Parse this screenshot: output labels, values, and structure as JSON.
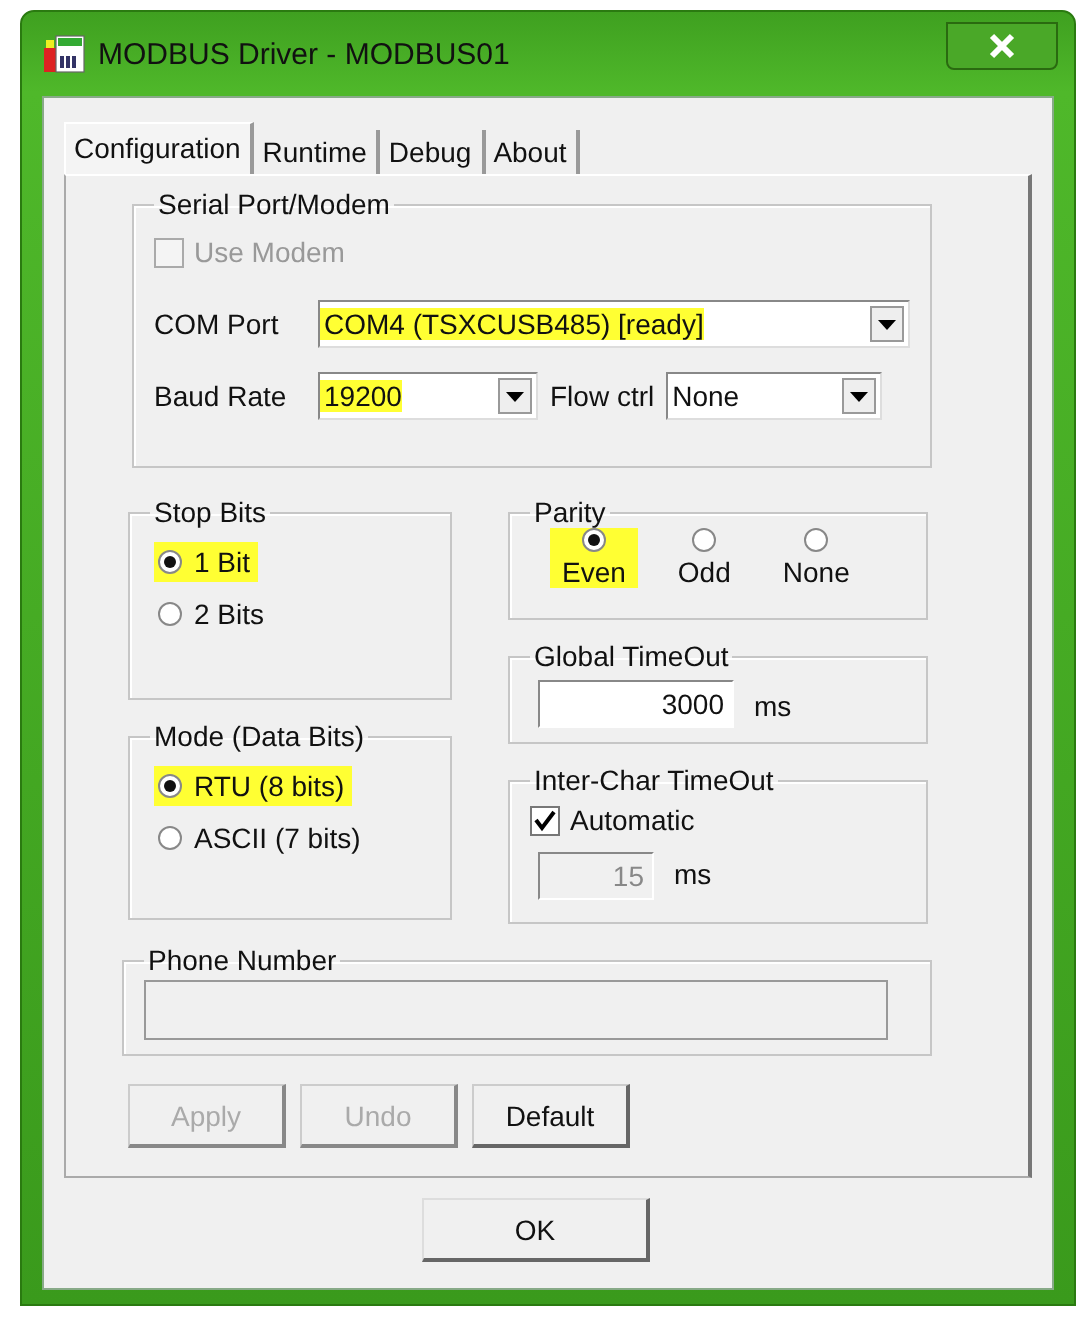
{
  "window": {
    "title": "MODBUS Driver - MODBUS01"
  },
  "tabs": [
    {
      "label": "Configuration",
      "selected": true
    },
    {
      "label": "Runtime",
      "selected": false
    },
    {
      "label": "Debug",
      "selected": false
    },
    {
      "label": "About",
      "selected": false
    }
  ],
  "serial_port": {
    "title": "Serial Port/Modem",
    "use_modem": {
      "label": "Use Modem",
      "checked": false,
      "disabled": true
    },
    "com_port": {
      "label": "COM Port",
      "value": "COM4 (TSXCUSB485) [ready]",
      "highlighted": true
    },
    "baud_rate": {
      "label": "Baud Rate",
      "value": "19200",
      "highlighted": true
    },
    "flow_ctrl": {
      "label": "Flow ctrl",
      "value": "None",
      "highlighted": false
    }
  },
  "stop_bits": {
    "title": "Stop Bits",
    "options": [
      {
        "label": "1 Bit",
        "selected": true,
        "highlighted": true
      },
      {
        "label": "2 Bits",
        "selected": false,
        "highlighted": false
      }
    ]
  },
  "mode": {
    "title": "Mode (Data Bits)",
    "options": [
      {
        "label": "RTU (8 bits)",
        "selected": true,
        "highlighted": true
      },
      {
        "label": "ASCII (7 bits)",
        "selected": false,
        "highlighted": false
      }
    ]
  },
  "parity": {
    "title": "Parity",
    "options": [
      {
        "label": "Even",
        "selected": true,
        "highlighted": true
      },
      {
        "label": "Odd",
        "selected": false,
        "highlighted": false
      },
      {
        "label": "None",
        "selected": false,
        "highlighted": false
      }
    ]
  },
  "global_timeout": {
    "title": "Global TimeOut",
    "value": "3000",
    "unit": "ms",
    "disabled": false
  },
  "inter_char_timeout": {
    "title": "Inter-Char TimeOut",
    "automatic": {
      "label": "Automatic",
      "checked": true
    },
    "value": "15",
    "unit": "ms",
    "disabled": true
  },
  "phone_number": {
    "title": "Phone Number",
    "disabled": true
  },
  "buttons": [
    {
      "label": "Apply",
      "disabled": true
    },
    {
      "label": "Undo",
      "disabled": true
    },
    {
      "label": "Default",
      "disabled": false
    }
  ],
  "ok_button": {
    "label": "OK"
  }
}
